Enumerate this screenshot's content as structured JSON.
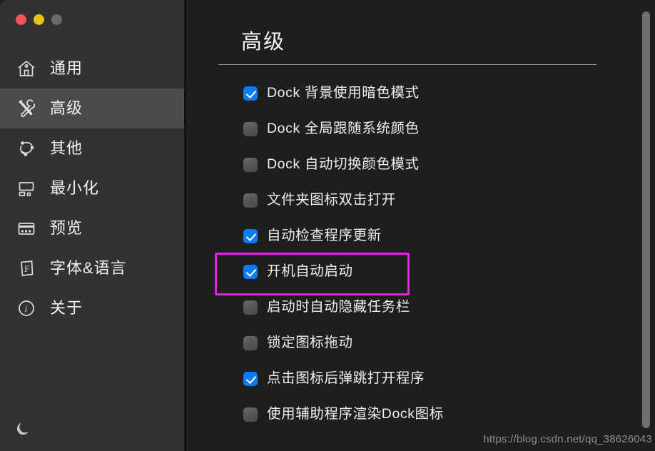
{
  "window": {
    "traffic_lights": [
      {
        "name": "close",
        "color": "#f9515a"
      },
      {
        "name": "minimize",
        "color": "#e7c518"
      },
      {
        "name": "zoom",
        "color": "#6b6b6b"
      }
    ]
  },
  "sidebar": {
    "items": [
      {
        "icon": "home-icon",
        "label": "通用",
        "selected": false
      },
      {
        "icon": "tools-icon",
        "label": "高级",
        "selected": true
      },
      {
        "icon": "molecule-icon",
        "label": "其他",
        "selected": false
      },
      {
        "icon": "minimize-icon",
        "label": "最小化",
        "selected": false
      },
      {
        "icon": "preview-icon",
        "label": "预览",
        "selected": false
      },
      {
        "icon": "font-icon",
        "label": "字体&语言",
        "selected": false
      },
      {
        "icon": "info-icon",
        "label": "关于",
        "selected": false
      }
    ],
    "theme_toggle": {
      "icon": "moon-icon",
      "label": ""
    }
  },
  "main": {
    "title": "高级",
    "options": [
      {
        "label": "Dock 背景使用暗色模式",
        "checked": true,
        "highlighted": false
      },
      {
        "label": "Dock 全局跟随系统颜色",
        "checked": false,
        "highlighted": false
      },
      {
        "label": "Dock 自动切换颜色模式",
        "checked": false,
        "highlighted": false
      },
      {
        "label": "文件夹图标双击打开",
        "checked": false,
        "highlighted": false
      },
      {
        "label": "自动检查程序更新",
        "checked": true,
        "highlighted": false
      },
      {
        "label": "开机自动启动",
        "checked": true,
        "highlighted": true
      },
      {
        "label": "启动时自动隐藏任务栏",
        "checked": false,
        "highlighted": false
      },
      {
        "label": "锁定图标拖动",
        "checked": false,
        "highlighted": false
      },
      {
        "label": "点击图标后弹跳打开程序",
        "checked": true,
        "highlighted": false
      },
      {
        "label": "使用辅助程序渲染Dock图标",
        "checked": false,
        "highlighted": false
      }
    ],
    "watermark": "https://blog.csdn.net/qq_38626043"
  },
  "colors": {
    "accent_checked": "#0a7cf5",
    "highlight_box": "#e81ee8",
    "sidebar_bg": "#323232",
    "sidebar_selected_bg": "#4a4a4a",
    "main_bg": "#1e1e1e"
  }
}
